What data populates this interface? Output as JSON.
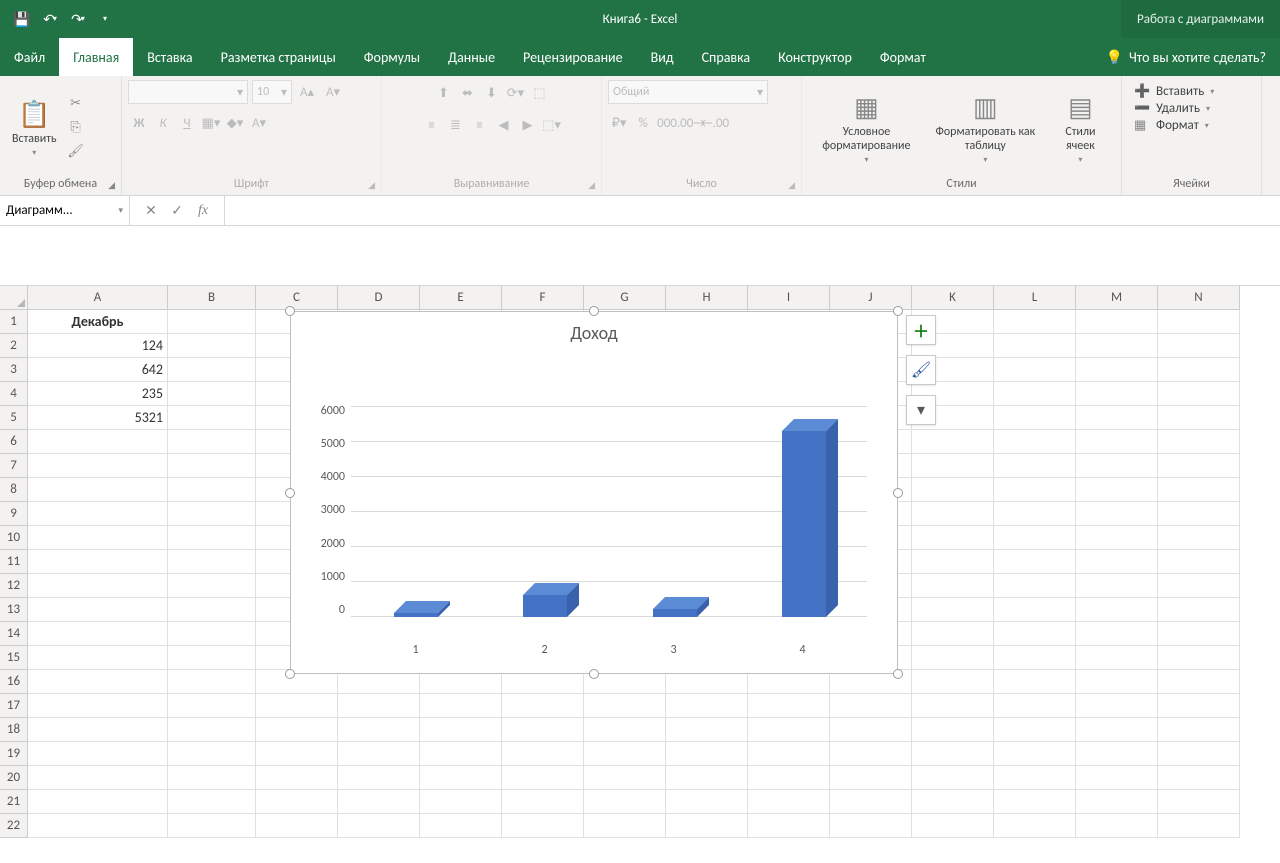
{
  "titlebar": {
    "doc_title": "Книга6  -  Excel",
    "chart_tools": "Работа с диаграммами"
  },
  "tabs": {
    "file": "Файл",
    "home": "Главная",
    "insert": "Вставка",
    "pagelayout": "Разметка страницы",
    "formulas": "Формулы",
    "data": "Данные",
    "review": "Рецензирование",
    "view": "Вид",
    "help": "Справка",
    "design": "Конструктор",
    "format": "Формат",
    "tellme": "Что вы хотите сделать?"
  },
  "ribbon": {
    "clipboard": {
      "paste": "Вставить",
      "label": "Буфер обмена"
    },
    "font": {
      "label": "Шрифт",
      "size": "10",
      "bold": "Ж",
      "italic": "К",
      "underline": "Ч"
    },
    "align": {
      "label": "Выравнивание"
    },
    "number": {
      "label": "Число",
      "format": "Общий"
    },
    "styles": {
      "cond": "Условное форматирование",
      "table": "Форматировать как таблицу",
      "cell": "Стили ячеек",
      "label": "Стили"
    },
    "cells": {
      "insert": "Вставить",
      "delete": "Удалить",
      "format": "Формат",
      "label": "Ячейки"
    }
  },
  "namebox": "Диаграмм...",
  "columns": [
    "A",
    "B",
    "C",
    "D",
    "E",
    "F",
    "G",
    "H",
    "I",
    "J",
    "K",
    "L",
    "M",
    "N"
  ],
  "sheet": {
    "rows_visible": 22,
    "A1": "Декабрь",
    "A2": "124",
    "A3": "642",
    "A4": "235",
    "A5": "5321"
  },
  "chart_data": {
    "type": "bar",
    "title": "Доход",
    "categories": [
      "1",
      "2",
      "3",
      "4"
    ],
    "values": [
      124,
      642,
      235,
      5321
    ],
    "ylim": [
      0,
      6000
    ],
    "ytick": 1000,
    "xlabel": "",
    "ylabel": ""
  }
}
